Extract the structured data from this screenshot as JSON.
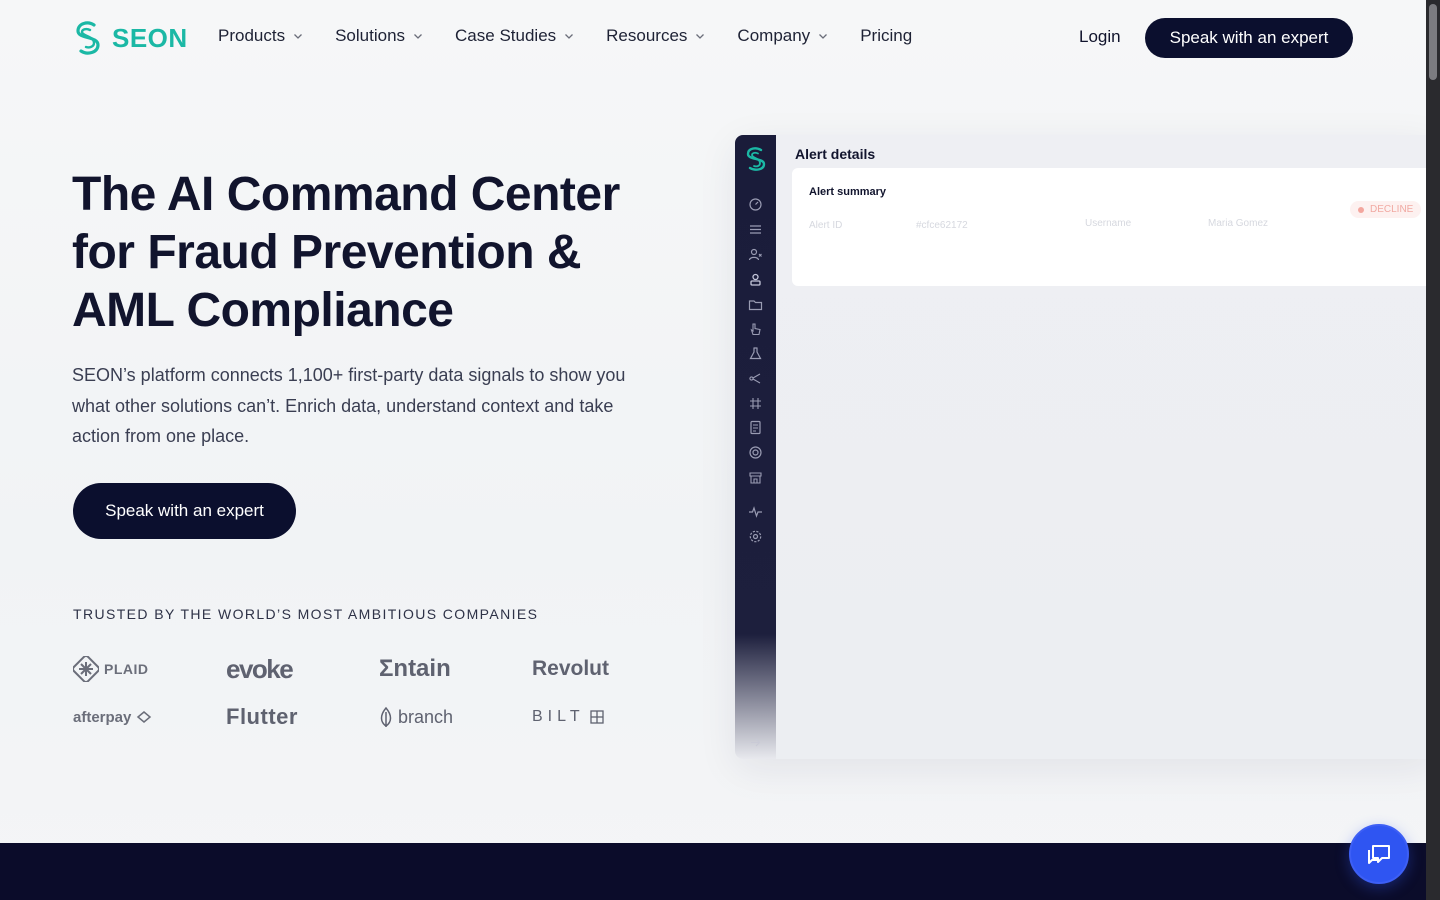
{
  "header": {
    "brand": "SEON",
    "nav": [
      {
        "label": "Products",
        "has_dropdown": true
      },
      {
        "label": "Solutions",
        "has_dropdown": true
      },
      {
        "label": "Case Studies",
        "has_dropdown": true
      },
      {
        "label": "Resources",
        "has_dropdown": true
      },
      {
        "label": "Company",
        "has_dropdown": true
      },
      {
        "label": "Pricing",
        "has_dropdown": false
      }
    ],
    "login": "Login",
    "cta": "Speak with an expert"
  },
  "hero": {
    "title_lines": [
      "The AI Command Center",
      "for Fraud Prevention &",
      "AML Compliance"
    ],
    "subtitle": "SEON’s platform connects 1,100+ first-party data signals to show you what other solutions can’t. Enrich data, understand context and take action from one place.",
    "cta": "Speak with an expert"
  },
  "trusted": {
    "heading": "TRUSTED BY THE WORLD’S MOST AMBITIOUS COMPANIES",
    "logos": [
      "PLAID",
      "evoke",
      "Σntain",
      "Revolut",
      "afterpay",
      "Flutter",
      "branch",
      "BILT"
    ]
  },
  "preview": {
    "page_title": "Alert details",
    "card_title": "Alert summary",
    "fields": [
      {
        "label": "Alert ID",
        "value": "#cfce62172"
      },
      {
        "label": "Username",
        "value": "Maria Gomez"
      }
    ],
    "status": "DECLINE",
    "sidebar_icons": [
      "dashboard-icon",
      "list-icon",
      "users-icon",
      "user-lock-icon",
      "folder-icon",
      "pointer-icon",
      "flask-icon",
      "share-icon",
      "grid-icon",
      "document-icon",
      "target-icon",
      "store-icon",
      "activity-icon",
      "settings-icon",
      "collapse-icon"
    ]
  },
  "colors": {
    "brand_teal": "#1bb8a5",
    "navy": "#0b0f2e",
    "chat_blue": "#2f55f2"
  }
}
